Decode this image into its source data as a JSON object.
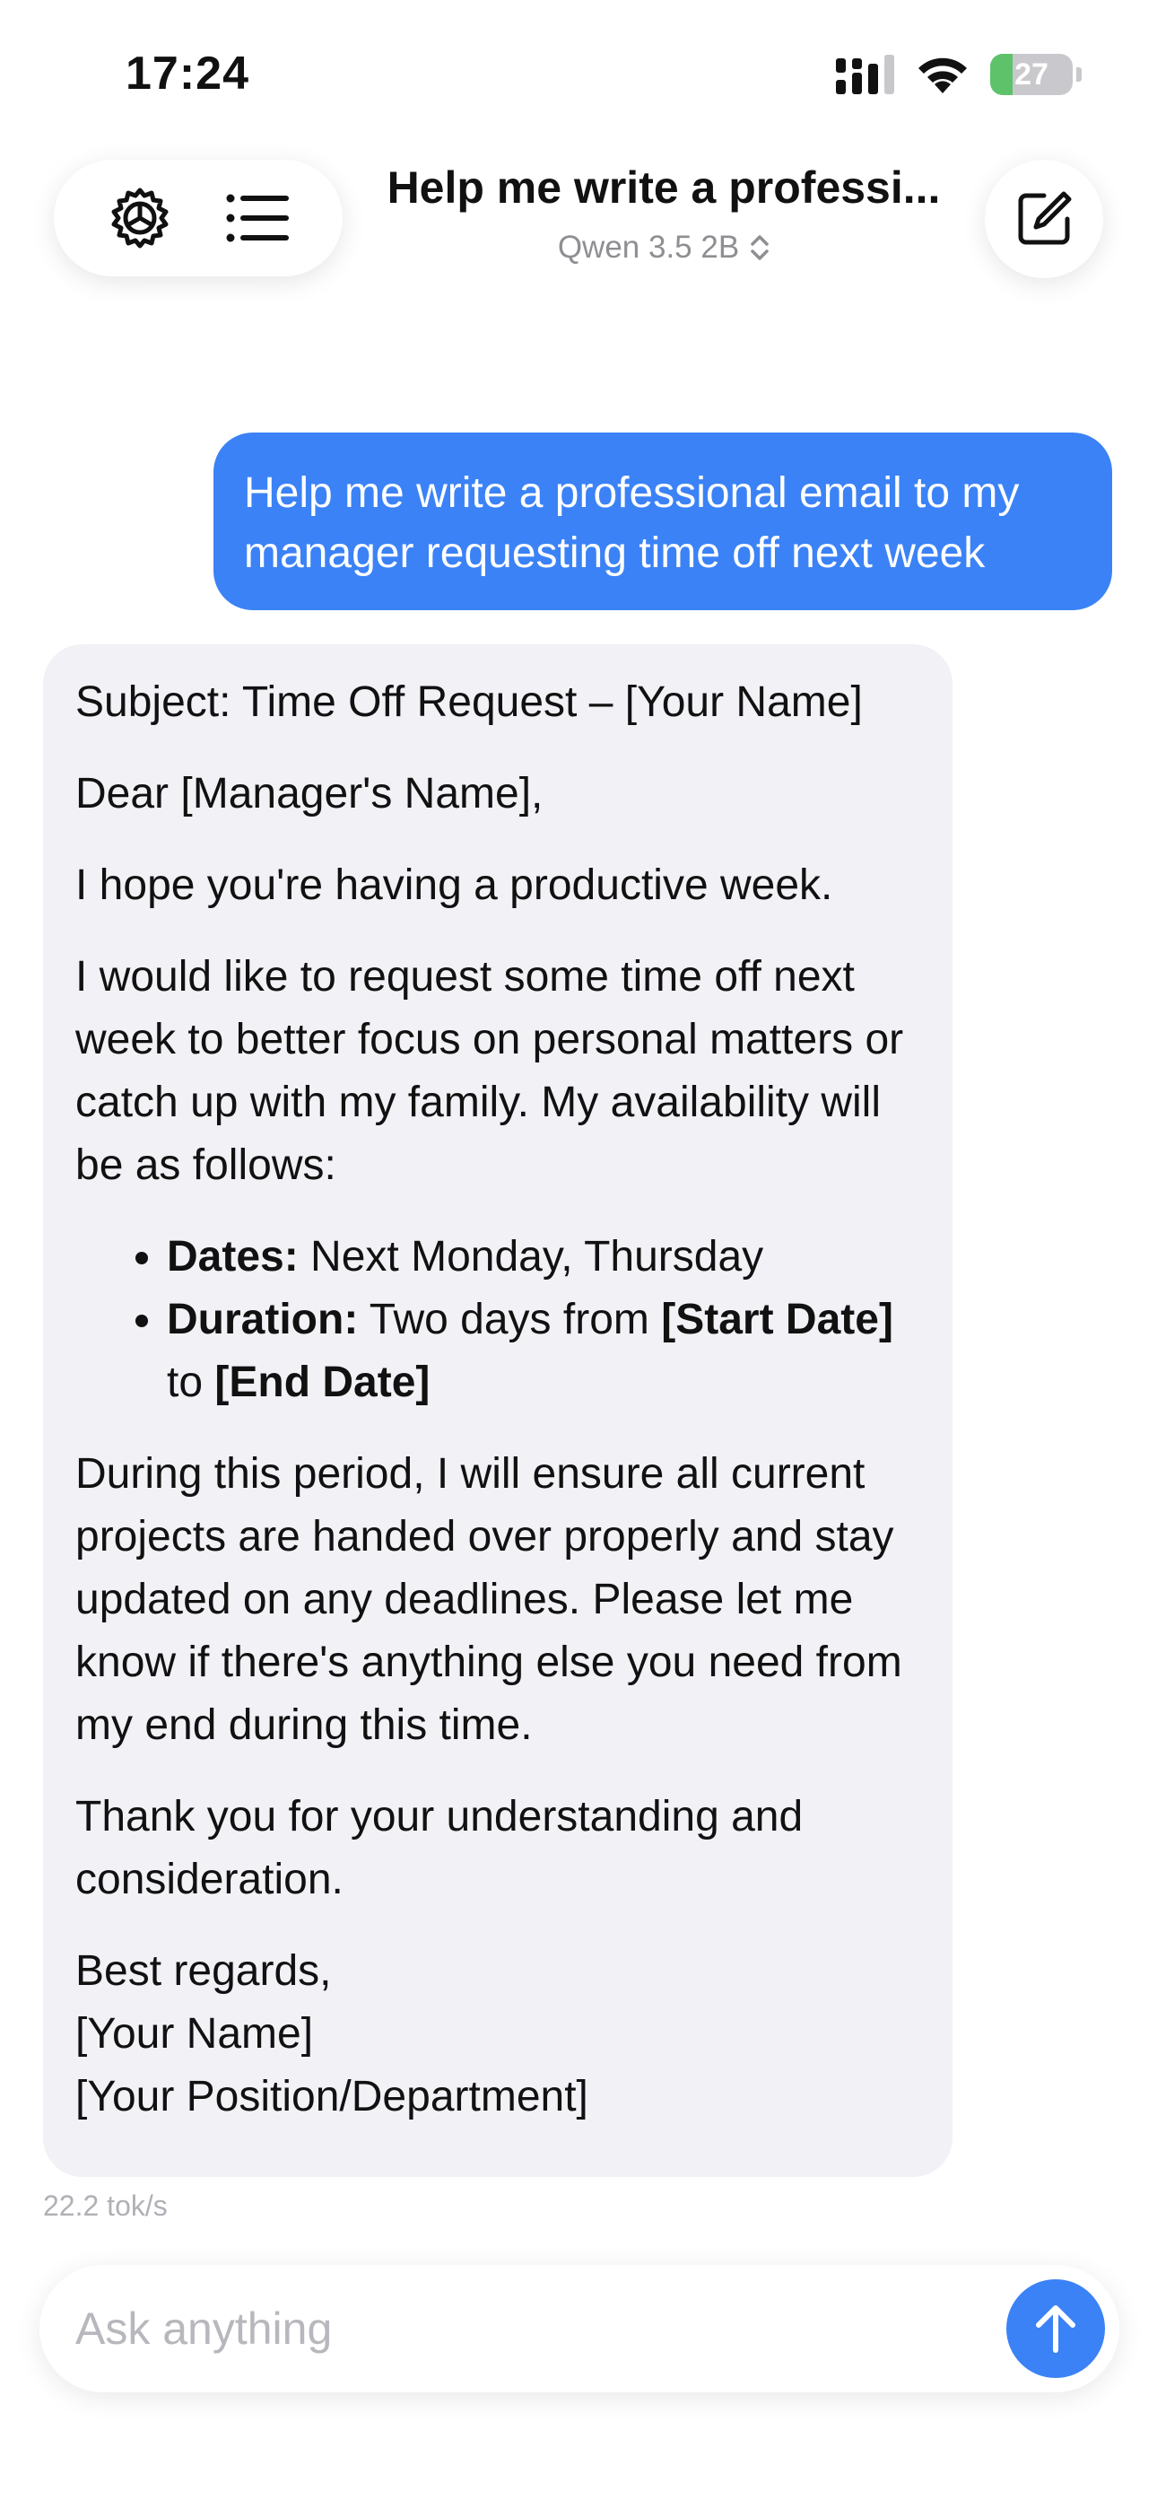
{
  "status_bar": {
    "time": "17:24",
    "battery_level": "27",
    "battery_fraction": 0.27,
    "icons": [
      "cellular-signal-icon",
      "wifi-icon",
      "battery-charging-icon"
    ]
  },
  "header": {
    "title": "Help me write a professi...",
    "model_name": "Qwen 3.5 2B",
    "icons": [
      "settings-gear-icon",
      "list-icon",
      "new-chat-compose-icon",
      "chevron-up-down-icon"
    ]
  },
  "messages": {
    "user_text": "Help me write a professional email to my manager requesting time off next week",
    "assistant": {
      "subject": "Subject: Time Off Request – [Your Name]",
      "greeting": "Dear [Manager's Name],",
      "opening": "I hope you're having a productive week.",
      "body1": "I would like to request some time off next week to better focus on personal matters or catch up with my family. My availability will be as follows:",
      "bullets": {
        "dates_label": "Dates:",
        "dates_value": " Next Monday, Thursday",
        "duration_label": "Duration:",
        "duration_text1": " Two days from ",
        "duration_start": "[Start Date]",
        "duration_text2": " to ",
        "duration_end": "[End Date]"
      },
      "body2": "During this period, I will ensure all current projects are handed over properly and stay updated on any deadlines. Please let me know if there's anything else you need from my end during this time.",
      "thanks": "Thank you for your understanding and consideration.",
      "closing": "Best regards,",
      "sig_name": "[Your Name]",
      "sig_position": "[Your Position/Department]"
    },
    "tok_speed": "22.2 tok/s"
  },
  "input": {
    "placeholder": "Ask anything",
    "value": ""
  },
  "colors": {
    "accent": "#3b82f6",
    "assistant_bubble": "#f1f1f6",
    "battery_green": "#5ec26a"
  }
}
